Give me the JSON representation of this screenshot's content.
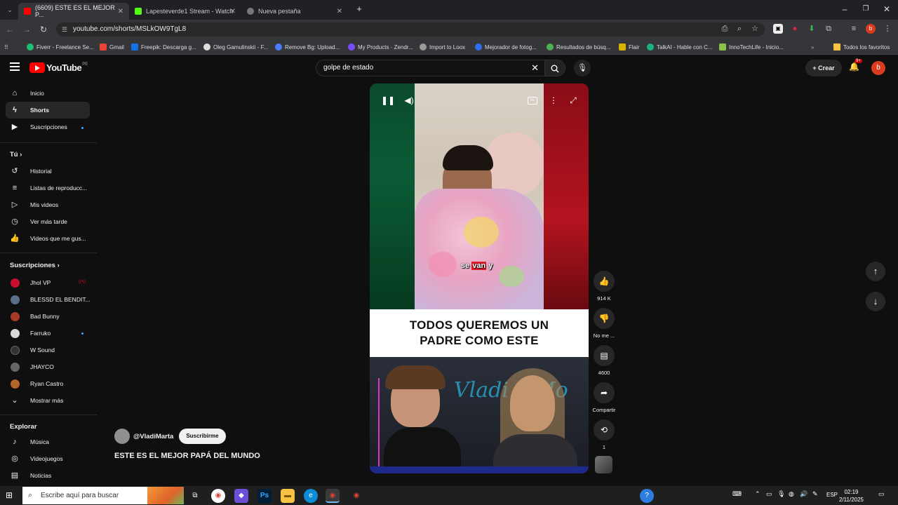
{
  "browser": {
    "tabs": [
      {
        "title": "(6609) ESTE ES EL MEJOR P...",
        "active": true
      },
      {
        "title": "Lapesteverde1 Stream - Watch",
        "active": false
      },
      {
        "title": "Nueva pestaña",
        "active": false
      }
    ],
    "url": "youtube.com/shorts/MSLkOW9TgL8",
    "bookmarks": [
      "Fiverr - Freelance Se...",
      "Gmail",
      "Freepik: Descarga g...",
      "Oleg Gamulinskii - F...",
      "Remove Bg: Upload...",
      "My Products · Zendr...",
      "Import to Loox",
      "Mejorador de fotog...",
      "Resultados de búsq...",
      "Flair",
      "TalkAI - Hable con C...",
      "InnoTechLife - Inicio..."
    ],
    "all_bookmarks": "Todos los favoritos"
  },
  "youtube": {
    "logo_text": "YouTube",
    "country": "PE",
    "search_query": "golpe de estado",
    "create_label": "Crear",
    "notif_count": "9+",
    "avatar_letter": "b"
  },
  "sidebar": {
    "main": [
      {
        "label": "Inicio",
        "icon": "home-icon"
      },
      {
        "label": "Shorts",
        "icon": "shorts-icon"
      },
      {
        "label": "Suscripciones",
        "icon": "subscriptions-icon"
      }
    ],
    "you_header": "Tú",
    "you": [
      {
        "label": "Historial",
        "icon": "history-icon"
      },
      {
        "label": "Listas de reproducc...",
        "icon": "playlists-icon"
      },
      {
        "label": "Mis videos",
        "icon": "my-videos-icon"
      },
      {
        "label": "Ver más tarde",
        "icon": "watch-later-icon"
      },
      {
        "label": "Videos que me gus...",
        "icon": "liked-icon"
      }
    ],
    "subs_header": "Suscripciones",
    "subs": [
      {
        "label": "Jhol VP",
        "color": "#c8102e"
      },
      {
        "label": "BLESSD EL BENDIT...",
        "color": "#5b6e8a"
      },
      {
        "label": "Bad Bunny",
        "color": "#a83a2a"
      },
      {
        "label": "Farruko",
        "color": "#d9d9d9"
      },
      {
        "label": "W Sound",
        "color": "#333333"
      },
      {
        "label": "JHAYCO",
        "color": "#666666"
      },
      {
        "label": "Ryan Castro",
        "color": "#b5652a"
      }
    ],
    "show_more": "Mostrar más",
    "explore_header": "Explorar",
    "explore": [
      {
        "label": "Música",
        "icon": "music-icon"
      },
      {
        "label": "Videojuegos",
        "icon": "gaming-icon"
      },
      {
        "label": "Noticias",
        "icon": "news-icon"
      }
    ]
  },
  "short": {
    "caption_pre": "se",
    "caption_hl": "van",
    "caption_post": "y",
    "band_line1": "TODOS QUEREMOS UN",
    "band_line2": "PADRE COMO ESTE",
    "neon_text": "Vladi y Mo",
    "channel": "@VladiMarta",
    "subscribe": "Suscribirme",
    "title": "ESTE ES EL MEJOR PAPÁ DEL MUNDO"
  },
  "actions": {
    "likes": "914 K",
    "dislike": "No me ...",
    "comments": "4600",
    "share": "Compartir",
    "remix": "1"
  },
  "taskbar": {
    "search_placeholder": "Escribe aquí para buscar",
    "lang": "ESP",
    "time": "02:19",
    "date": "2/11/2025"
  }
}
